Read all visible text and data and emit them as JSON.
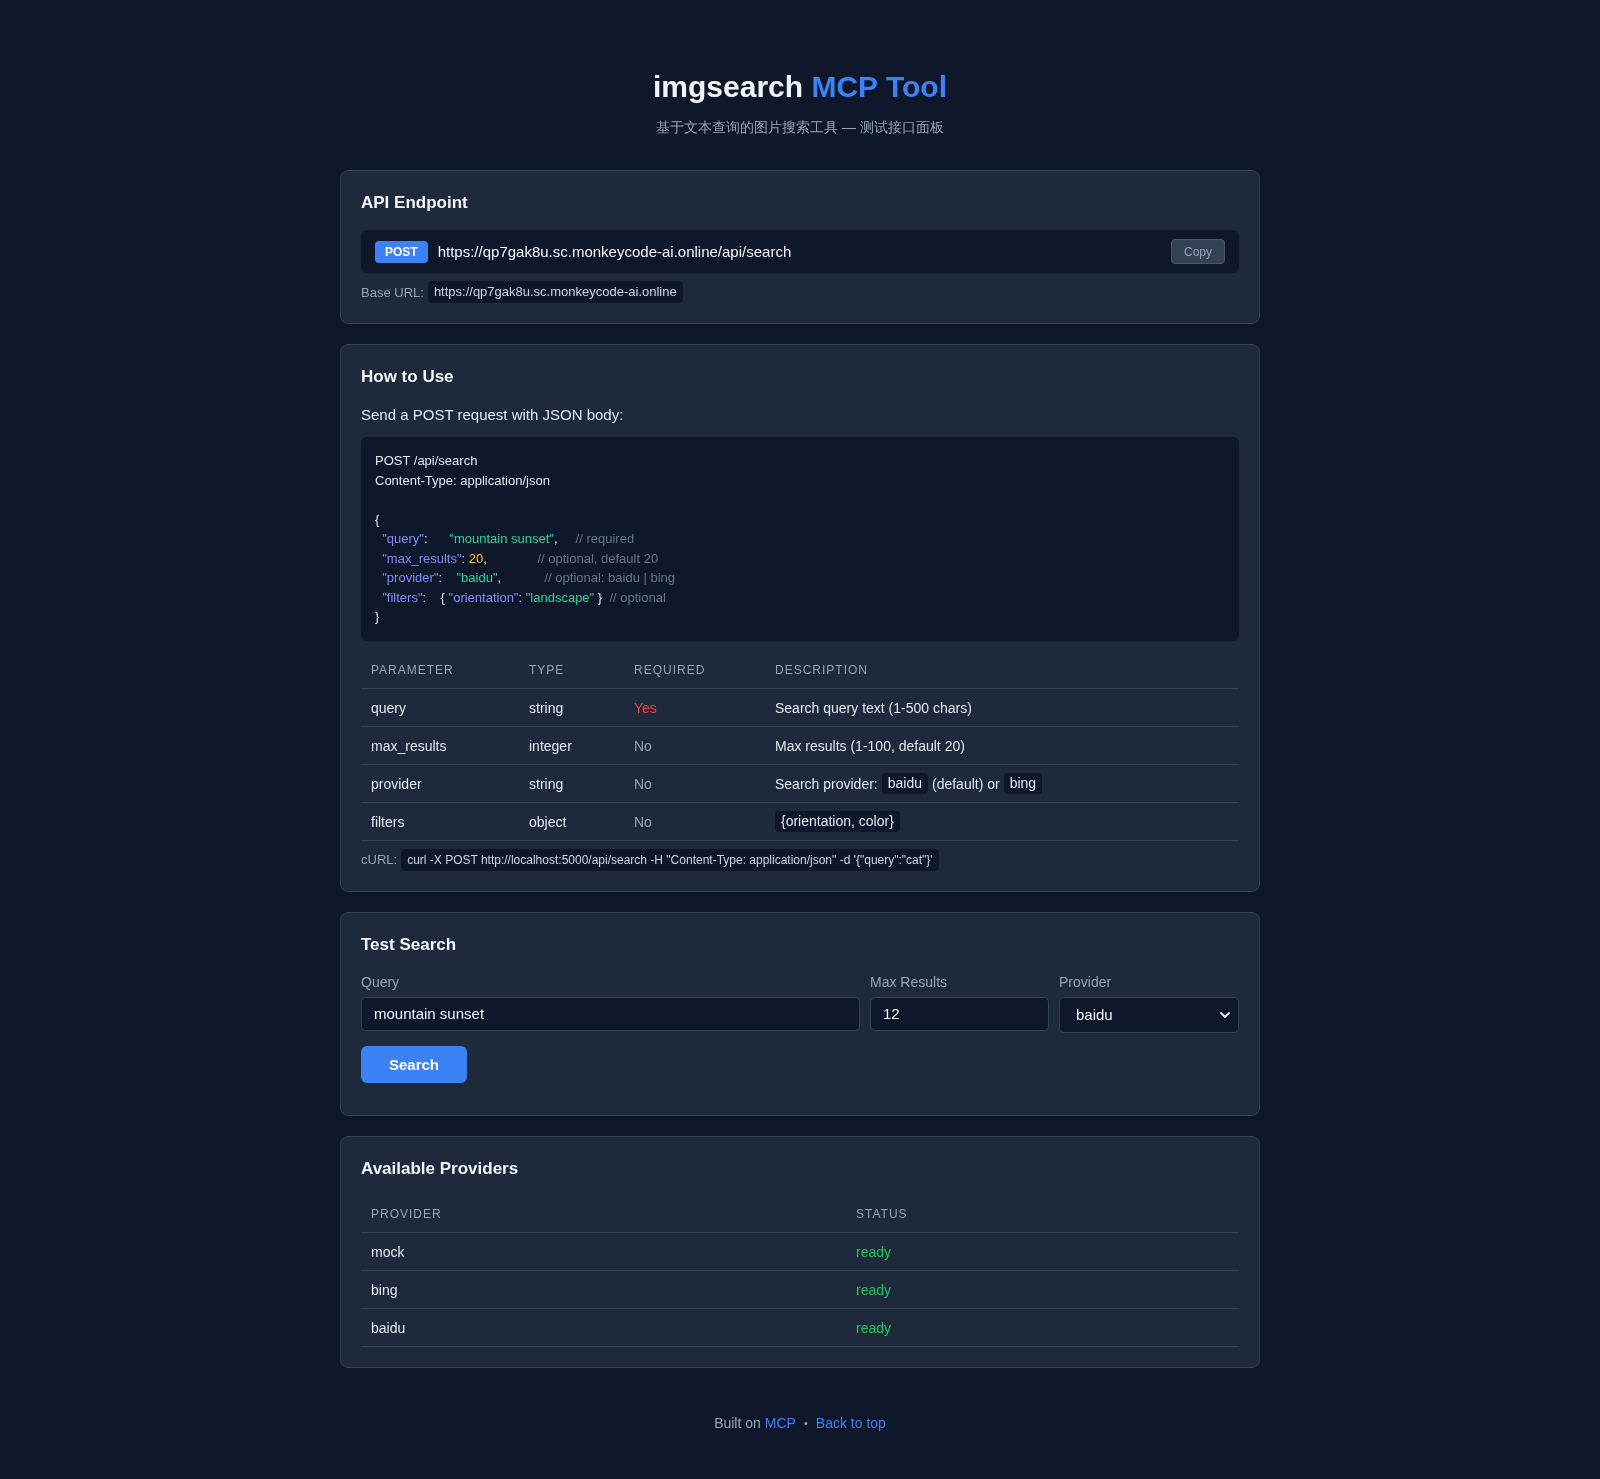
{
  "header": {
    "title": "imgsearch",
    "title_accent": "MCP Tool",
    "subtitle": "基于文本查询的图片搜索工具 — 测试接口面板"
  },
  "endpoint": {
    "heading": "API Endpoint",
    "method": "POST",
    "url": "https://qp7gak8u.sc.monkeycode-ai.online/api/search",
    "copy_button": "Copy",
    "base_label": "Base URL:",
    "base_url": "https://qp7gak8u.sc.monkeycode-ai.online"
  },
  "usage": {
    "heading": "How to Use",
    "intro": "Send a POST request with JSON body:",
    "request_lines": [
      "POST /api/search",
      "Content-Type: application/json"
    ],
    "body_lines": [
      [
        {
          "kind": "plain",
          "text": "{"
        }
      ],
      [
        {
          "kind": "key",
          "text": "  \"query\""
        },
        {
          "kind": "plain",
          "text": ":      "
        },
        {
          "kind": "string",
          "text": "\"mountain sunset\""
        },
        {
          "kind": "plain",
          "text": ",     "
        },
        {
          "kind": "comment",
          "text": "// required"
        }
      ],
      [
        {
          "kind": "key",
          "text": "  \"max_results\""
        },
        {
          "kind": "plain",
          "text": ": "
        },
        {
          "kind": "number",
          "text": "20"
        },
        {
          "kind": "plain",
          "text": ",              "
        },
        {
          "kind": "comment",
          "text": "// optional, default 20"
        }
      ],
      [
        {
          "kind": "key",
          "text": "  \"provider\""
        },
        {
          "kind": "plain",
          "text": ":    "
        },
        {
          "kind": "string",
          "text": "\"baidu\""
        },
        {
          "kind": "plain",
          "text": ",            "
        },
        {
          "kind": "comment",
          "text": "// optional: baidu | bing"
        }
      ],
      [
        {
          "kind": "key",
          "text": "  \"filters\""
        },
        {
          "kind": "plain",
          "text": ":    { "
        },
        {
          "kind": "key",
          "text": "\"orientation\""
        },
        {
          "kind": "plain",
          "text": ": "
        },
        {
          "kind": "string",
          "text": "\"landscape\""
        },
        {
          "kind": "plain",
          "text": " }  "
        },
        {
          "kind": "comment",
          "text": "// optional"
        }
      ],
      [
        {
          "kind": "plain",
          "text": "}"
        }
      ]
    ],
    "params": {
      "columns": [
        "PARAMETER",
        "TYPE",
        "REQUIRED",
        "DESCRIPTION"
      ],
      "rows": [
        {
          "name": "query",
          "type": "string",
          "required_text": "Yes",
          "required": true,
          "description": [
            {
              "kind": "text",
              "text": "Search query text (1-500 chars)"
            }
          ]
        },
        {
          "name": "max_results",
          "type": "integer",
          "required_text": "No",
          "required": false,
          "description": [
            {
              "kind": "text",
              "text": "Max results (1-100, default 20)"
            }
          ]
        },
        {
          "name": "provider",
          "type": "string",
          "required_text": "No",
          "required": false,
          "description": [
            {
              "kind": "text",
              "text": "Search provider:"
            },
            {
              "kind": "code",
              "text": "baidu"
            },
            {
              "kind": "text",
              "text": "(default) or"
            },
            {
              "kind": "code",
              "text": "bing"
            }
          ]
        },
        {
          "name": "filters",
          "type": "object",
          "required_text": "No",
          "required": false,
          "description": [
            {
              "kind": "code",
              "text": "{orientation, color}"
            }
          ]
        }
      ]
    },
    "curl_label": "cURL:",
    "curl": "curl -X POST http://localhost:5000/api/search -H \"Content-Type: application/json\" -d '{\"query\":\"cat\"}'"
  },
  "test_search": {
    "heading": "Test Search",
    "fields": [
      {
        "kind": "text",
        "label": "Query",
        "value": "mountain sunset"
      },
      {
        "kind": "number",
        "label": "Max Results",
        "value": "12"
      },
      {
        "kind": "select",
        "label": "Provider",
        "value": "baidu"
      }
    ],
    "button": "Search"
  },
  "providers": {
    "heading": "Available Providers",
    "columns": [
      "PROVIDER",
      "STATUS"
    ],
    "rows": [
      {
        "name": "mock",
        "status": "ready",
        "color": "#22c55e"
      },
      {
        "name": "bing",
        "status": "ready",
        "color": "#22c55e"
      },
      {
        "name": "baidu",
        "status": "ready",
        "color": "#22c55e"
      }
    ]
  },
  "footer": {
    "text": "Built on",
    "link": "MCP",
    "separator": "•",
    "back_link": "Back to top"
  }
}
